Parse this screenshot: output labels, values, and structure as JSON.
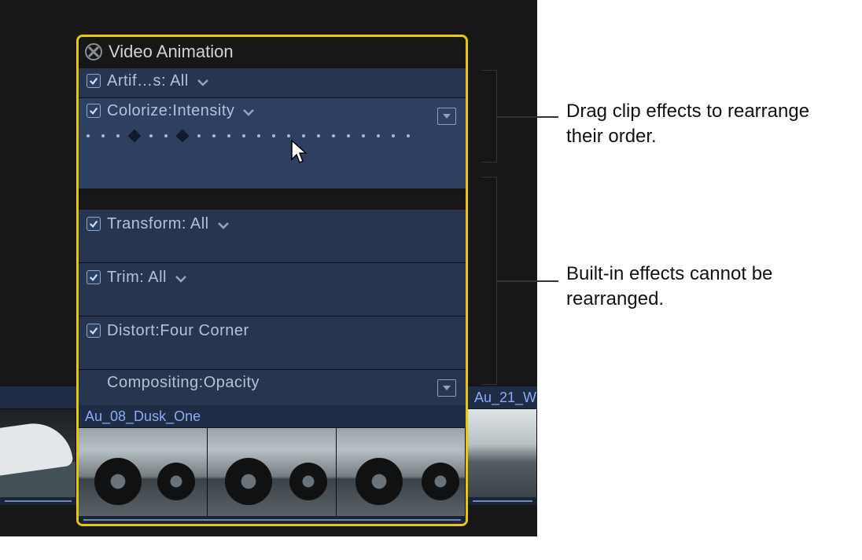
{
  "panel": {
    "title": "Video Animation",
    "effects": [
      {
        "label": "Artif…s: All",
        "hasCheckbox": true,
        "hasChevron": true
      },
      {
        "label": "Colorize:Intensity",
        "hasCheckbox": true,
        "hasChevron": true,
        "hasExpand": true,
        "hasKeyframes": true
      }
    ],
    "builtins": [
      {
        "label": "Transform: All",
        "hasCheckbox": true,
        "hasChevron": true
      },
      {
        "label": "Trim: All",
        "hasCheckbox": true,
        "hasChevron": true
      },
      {
        "label": "Distort:Four Corner",
        "hasCheckbox": true,
        "hasChevron": false
      },
      {
        "label": "Compositing:Opacity",
        "hasCheckbox": false,
        "hasChevron": false,
        "hasExpand": true
      }
    ],
    "clip_name": "Au_08_Dusk_One",
    "neighbor_clip": "Au_21_W"
  },
  "callouts": {
    "drag": "Drag clip effects to rearrange their order.",
    "builtin": "Built-in effects cannot be rearranged."
  }
}
